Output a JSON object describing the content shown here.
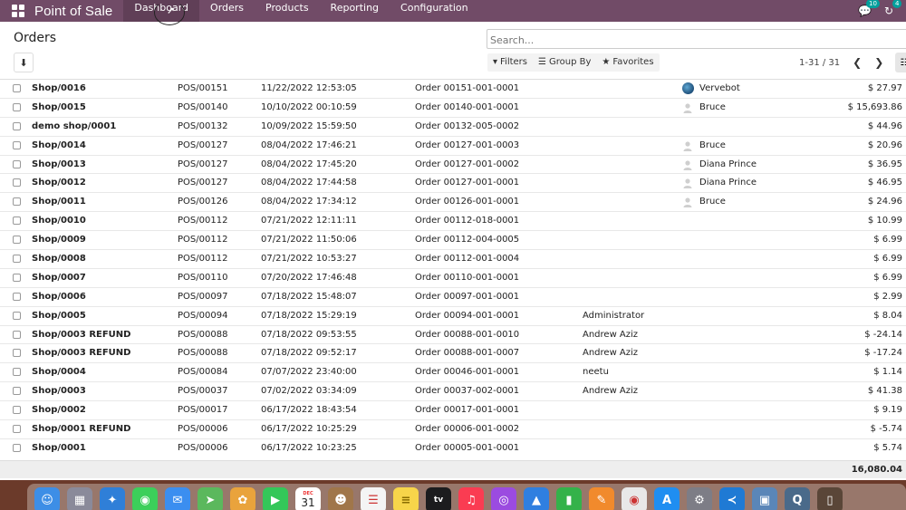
{
  "app": {
    "title": "Point of Sale",
    "nav": [
      "Dashboard",
      "Orders",
      "Products",
      "Reporting",
      "Configuration"
    ],
    "active_nav": "Dashboard",
    "messages_count": "10",
    "activities_count": "4"
  },
  "control": {
    "title": "Orders",
    "search_placeholder": "Search...",
    "filters_label": "Filters",
    "group_by_label": "Group By",
    "favorites_label": "Favorites",
    "pager": "1-31 / 31"
  },
  "orders": [
    {
      "name": "Shop/0016",
      "session": "POS/00151",
      "date": "11/22/2022 12:53:05",
      "ref": "Order 00151-001-0001",
      "employee": "",
      "customer": "Vervebot",
      "customer_icon": "bot-avatar-icon",
      "total": "$ 27.97"
    },
    {
      "name": "Shop/0015",
      "session": "POS/00140",
      "date": "10/10/2022 00:10:59",
      "ref": "Order 00140-001-0001",
      "employee": "",
      "customer": "Bruce",
      "customer_icon": "placeholder-avatar-icon",
      "total": "$ 15,693.86"
    },
    {
      "name": "demo shop/0001",
      "session": "POS/00132",
      "date": "10/09/2022 15:59:50",
      "ref": "Order 00132-005-0002",
      "employee": "",
      "customer": "",
      "customer_icon": "",
      "total": "$ 44.96"
    },
    {
      "name": "Shop/0014",
      "session": "POS/00127",
      "date": "08/04/2022 17:46:21",
      "ref": "Order 00127-001-0003",
      "employee": "",
      "customer": "Bruce",
      "customer_icon": "placeholder-avatar-icon",
      "total": "$ 20.96"
    },
    {
      "name": "Shop/0013",
      "session": "POS/00127",
      "date": "08/04/2022 17:45:20",
      "ref": "Order 00127-001-0002",
      "employee": "",
      "customer": "Diana Prince",
      "customer_icon": "placeholder-avatar-icon",
      "total": "$ 36.95"
    },
    {
      "name": "Shop/0012",
      "session": "POS/00127",
      "date": "08/04/2022 17:44:58",
      "ref": "Order 00127-001-0001",
      "employee": "",
      "customer": "Diana Prince",
      "customer_icon": "placeholder-avatar-icon",
      "total": "$ 46.95"
    },
    {
      "name": "Shop/0011",
      "session": "POS/00126",
      "date": "08/04/2022 17:34:12",
      "ref": "Order 00126-001-0001",
      "employee": "",
      "customer": "Bruce",
      "customer_icon": "placeholder-avatar-icon",
      "total": "$ 24.96"
    },
    {
      "name": "Shop/0010",
      "session": "POS/00112",
      "date": "07/21/2022 12:11:11",
      "ref": "Order 00112-018-0001",
      "employee": "",
      "customer": "",
      "customer_icon": "",
      "total": "$ 10.99"
    },
    {
      "name": "Shop/0009",
      "session": "POS/00112",
      "date": "07/21/2022 11:50:06",
      "ref": "Order 00112-004-0005",
      "employee": "",
      "customer": "",
      "customer_icon": "",
      "total": "$ 6.99"
    },
    {
      "name": "Shop/0008",
      "session": "POS/00112",
      "date": "07/21/2022 10:53:27",
      "ref": "Order 00112-001-0004",
      "employee": "",
      "customer": "",
      "customer_icon": "",
      "total": "$ 6.99"
    },
    {
      "name": "Shop/0007",
      "session": "POS/00110",
      "date": "07/20/2022 17:46:48",
      "ref": "Order 00110-001-0001",
      "employee": "",
      "customer": "",
      "customer_icon": "",
      "total": "$ 6.99"
    },
    {
      "name": "Shop/0006",
      "session": "POS/00097",
      "date": "07/18/2022 15:48:07",
      "ref": "Order 00097-001-0001",
      "employee": "",
      "customer": "",
      "customer_icon": "",
      "total": "$ 2.99"
    },
    {
      "name": "Shop/0005",
      "session": "POS/00094",
      "date": "07/18/2022 15:29:19",
      "ref": "Order 00094-001-0001",
      "employee": "Administrator",
      "customer": "",
      "customer_icon": "",
      "total": "$ 8.04"
    },
    {
      "name": "Shop/0003 REFUND",
      "session": "POS/00088",
      "date": "07/18/2022 09:53:55",
      "ref": "Order 00088-001-0010",
      "employee": "Andrew Aziz",
      "customer": "",
      "customer_icon": "",
      "total": "$ -24.14"
    },
    {
      "name": "Shop/0003 REFUND",
      "session": "POS/00088",
      "date": "07/18/2022 09:52:17",
      "ref": "Order 00088-001-0007",
      "employee": "Andrew Aziz",
      "customer": "",
      "customer_icon": "",
      "total": "$ -17.24"
    },
    {
      "name": "Shop/0004",
      "session": "POS/00084",
      "date": "07/07/2022 23:40:00",
      "ref": "Order 00046-001-0001",
      "employee": "neetu",
      "customer": "",
      "customer_icon": "",
      "total": "$ 1.14"
    },
    {
      "name": "Shop/0003",
      "session": "POS/00037",
      "date": "07/02/2022 03:34:09",
      "ref": "Order 00037-002-0001",
      "employee": "Andrew Aziz",
      "customer": "",
      "customer_icon": "",
      "total": "$ 41.38"
    },
    {
      "name": "Shop/0002",
      "session": "POS/00017",
      "date": "06/17/2022 18:43:54",
      "ref": "Order 00017-001-0001",
      "employee": "",
      "customer": "",
      "customer_icon": "",
      "total": "$ 9.19"
    },
    {
      "name": "Shop/0001 REFUND",
      "session": "POS/00006",
      "date": "06/17/2022 10:25:29",
      "ref": "Order 00006-001-0002",
      "employee": "",
      "customer": "",
      "customer_icon": "",
      "total": "$ -5.74"
    },
    {
      "name": "Shop/0001",
      "session": "POS/00006",
      "date": "06/17/2022 10:23:25",
      "ref": "Order 00005-001-0001",
      "employee": "",
      "customer": "",
      "customer_icon": "",
      "total": "$ 5.74"
    }
  ],
  "footer": {
    "grand_total": "16,080.04"
  },
  "dock": {
    "calendar_month": "DEC",
    "calendar_day": "31",
    "apps": [
      {
        "name": "finder-icon",
        "color": "#3d8ee6",
        "glyph": "☺"
      },
      {
        "name": "launchpad-icon",
        "color": "#8a8a9a",
        "glyph": "▦"
      },
      {
        "name": "safari-icon",
        "color": "#2f7fd8",
        "glyph": "✦"
      },
      {
        "name": "messages-icon",
        "color": "#3ccf5a",
        "glyph": "◉"
      },
      {
        "name": "mail-icon",
        "color": "#3b8ef0",
        "glyph": "✉"
      },
      {
        "name": "maps-icon",
        "color": "#5bb85d",
        "glyph": "➤"
      },
      {
        "name": "photos-icon",
        "color": "#e9a33c",
        "glyph": "✿"
      },
      {
        "name": "facetime-icon",
        "color": "#34c759",
        "glyph": "▶"
      },
      {
        "name": "calendar-icon",
        "color": "#ffffff",
        "glyph": ""
      },
      {
        "name": "contacts-icon",
        "color": "#a0764a",
        "glyph": "☻"
      },
      {
        "name": "reminders-icon",
        "color": "#f4f4f4",
        "glyph": "☰"
      },
      {
        "name": "notes-icon",
        "color": "#f7d54a",
        "glyph": "≡"
      },
      {
        "name": "tv-icon",
        "color": "#1c1c1e",
        "glyph": "tv"
      },
      {
        "name": "music-icon",
        "color": "#fa3c52",
        "glyph": "♫"
      },
      {
        "name": "podcasts-icon",
        "color": "#9b4be0",
        "glyph": "◎"
      },
      {
        "name": "keynote-icon",
        "color": "#2f7fe0",
        "glyph": "▲"
      },
      {
        "name": "numbers-icon",
        "color": "#34b24a",
        "glyph": "▮"
      },
      {
        "name": "pages-icon",
        "color": "#f18a2c",
        "glyph": "✎"
      },
      {
        "name": "chrome-icon",
        "color": "#e8e8e8",
        "glyph": "◉"
      },
      {
        "name": "app-store-icon",
        "color": "#1f8ef1",
        "glyph": "A"
      },
      {
        "name": "system-preferences-icon",
        "color": "#7d7d86",
        "glyph": "⚙"
      },
      {
        "name": "vscode-icon",
        "color": "#1f7ad4",
        "glyph": "≺"
      },
      {
        "name": "preview-icon",
        "color": "#5a86b8",
        "glyph": "▣"
      },
      {
        "name": "quicktime-icon",
        "color": "#4a6a8a",
        "glyph": "Q"
      },
      {
        "name": "trash-icon",
        "color": "#5a4638",
        "glyph": "▯"
      }
    ]
  }
}
